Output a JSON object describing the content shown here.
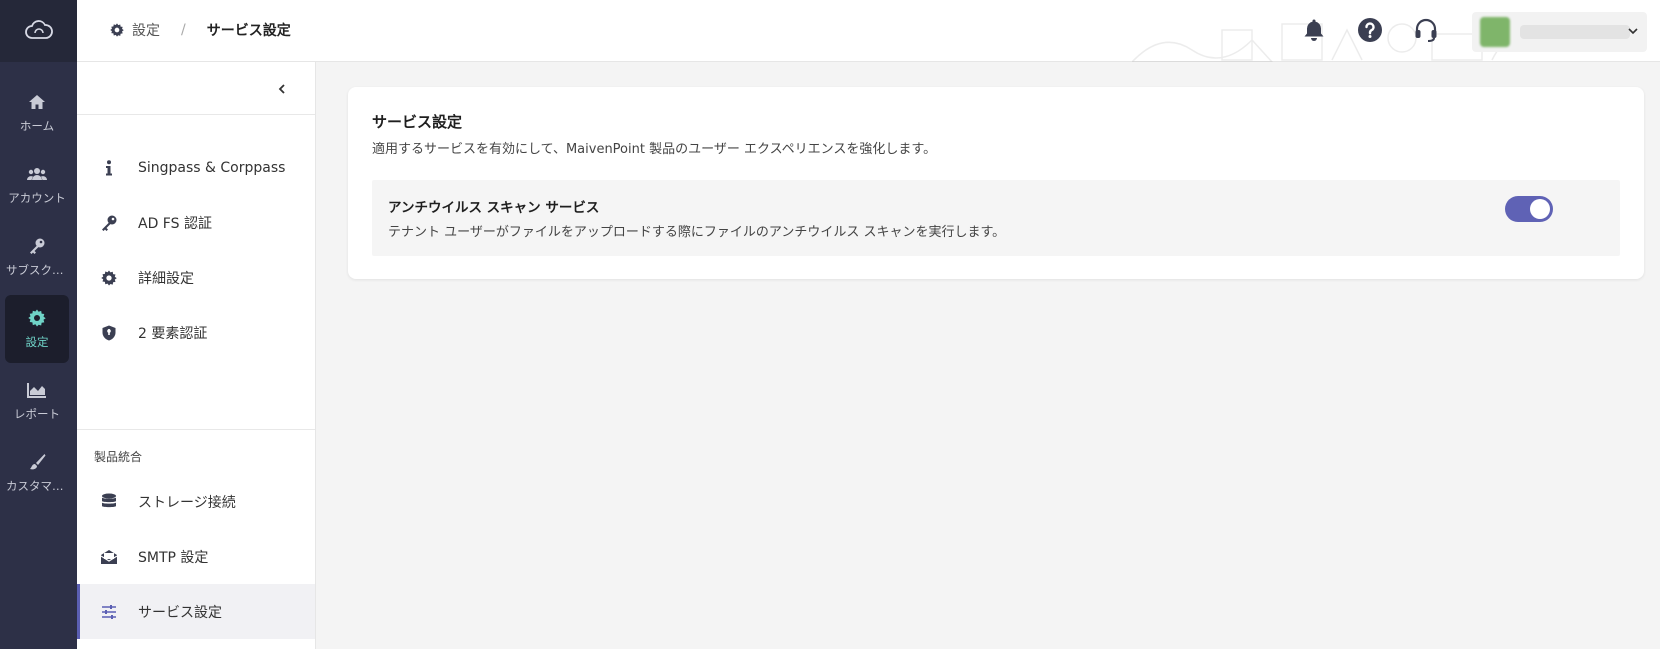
{
  "rail": {
    "items": [
      {
        "label": "ホーム",
        "icon": "home-icon"
      },
      {
        "label": "アカウント",
        "icon": "users-icon"
      },
      {
        "label": "サブスクリ…",
        "icon": "key-icon"
      },
      {
        "label": "設定",
        "icon": "gear-icon",
        "active": true
      },
      {
        "label": "レポート",
        "icon": "area-chart-icon"
      },
      {
        "label": "カスタマイズ",
        "icon": "brush-icon"
      }
    ]
  },
  "header": {
    "breadcrumb": {
      "root": "設定",
      "separator": "/",
      "current": "サービス設定"
    }
  },
  "subnav": {
    "items": [
      {
        "label": "Singpass & Corppass",
        "icon": "info-icon"
      },
      {
        "label": "AD FS 認証",
        "icon": "key-icon"
      },
      {
        "label": "詳細設定",
        "icon": "gear-icon"
      },
      {
        "label": "2 要素認証",
        "icon": "shield-icon"
      }
    ],
    "section_label": "製品統合",
    "section_items": [
      {
        "label": "ストレージ接続",
        "icon": "database-icon"
      },
      {
        "label": "SMTP 設定",
        "icon": "mail-open-icon"
      },
      {
        "label": "サービス設定",
        "icon": "sliders-icon",
        "active": true
      }
    ]
  },
  "main": {
    "title": "サービス設定",
    "description": "適用するサービスを有効にして、MaivenPoint 製品のユーザー エクスペリエンスを強化します。",
    "services": [
      {
        "name": "アンチウイルス スキャン サービス",
        "description": "テナント ユーザーがファイルをアップロードする際にファイルのアンチウイルス スキャンを実行します。",
        "enabled": true
      }
    ]
  },
  "colors": {
    "rail_bg": "#2d3047",
    "rail_active_text": "#6fd3c7",
    "accent": "#5f62b5",
    "page_bg": "#f4f4f4"
  }
}
